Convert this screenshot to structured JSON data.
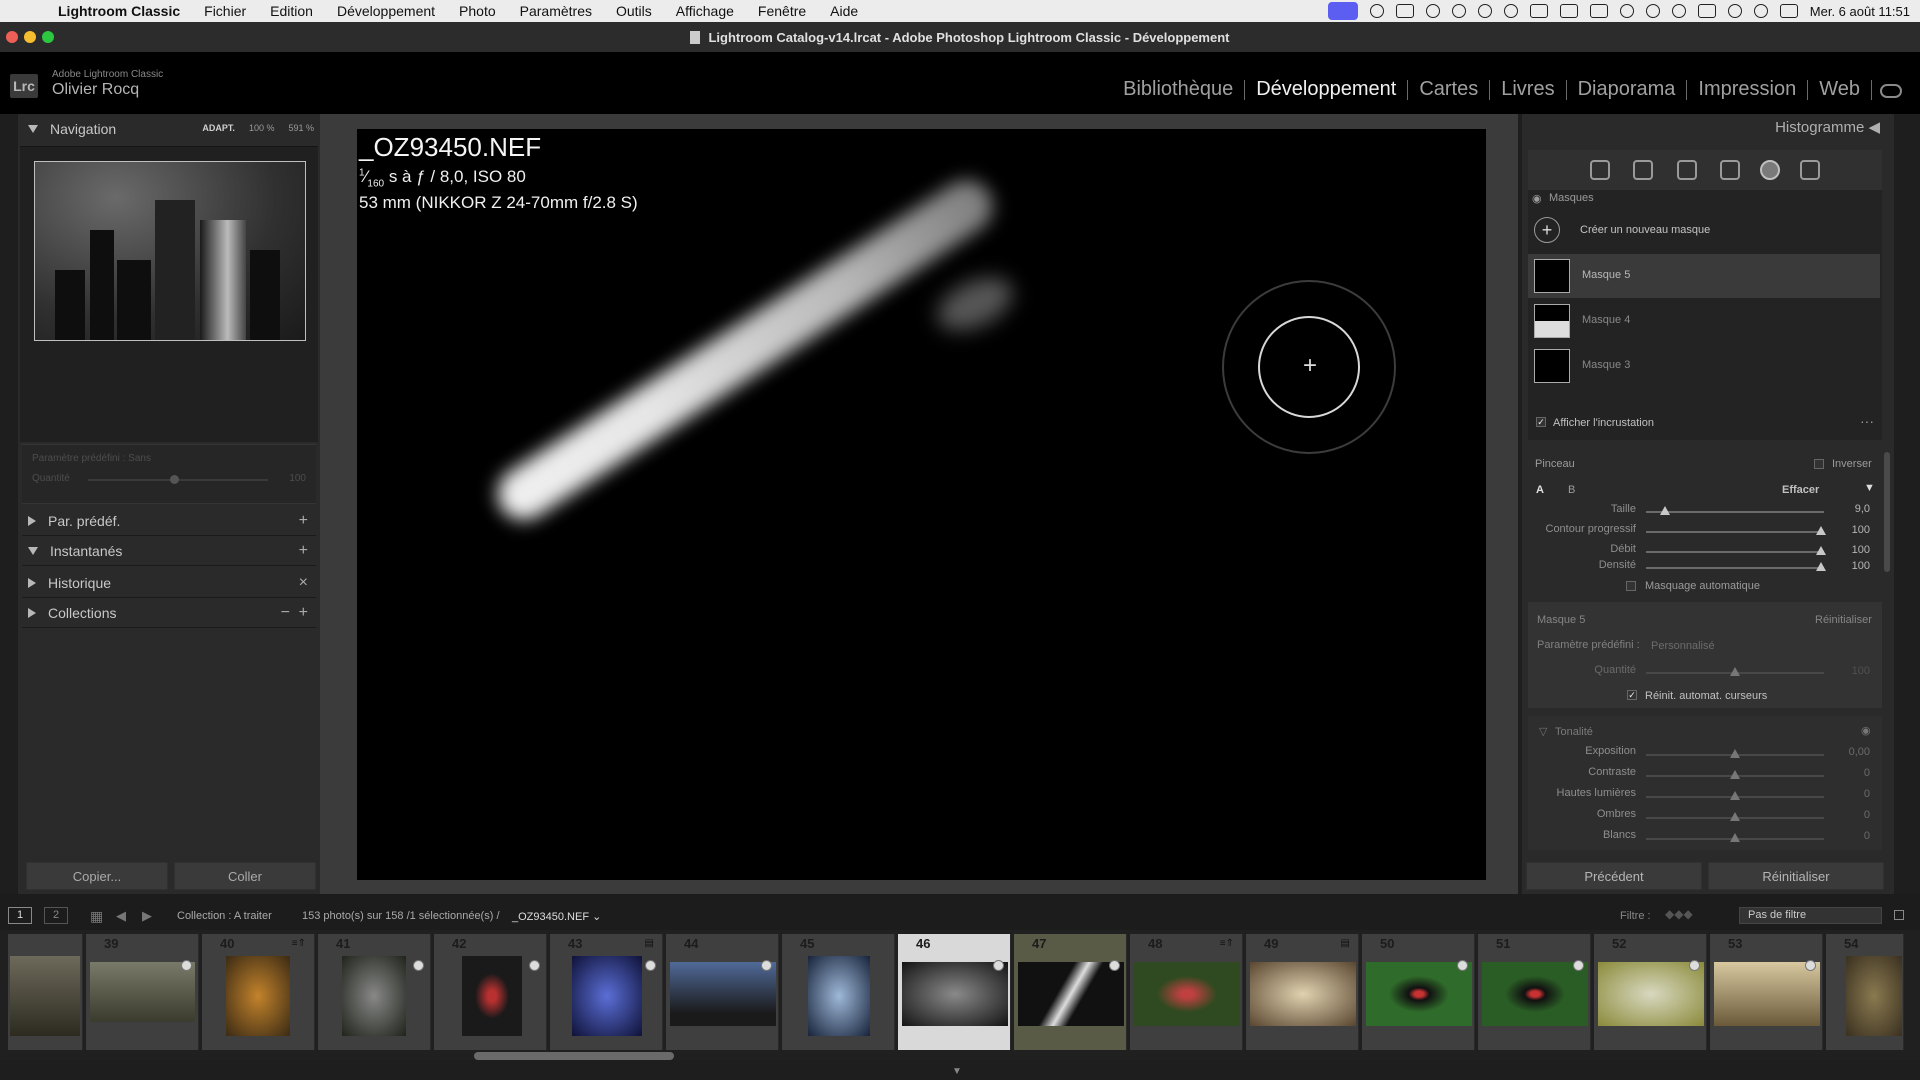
{
  "menubar": {
    "app": "Lightroom Classic",
    "items": [
      "Fichier",
      "Edition",
      "Développement",
      "Photo",
      "Paramètres",
      "Outils",
      "Affichage",
      "Fenêtre",
      "Aide"
    ],
    "datetime": "Mer. 6 août  11:51"
  },
  "window": {
    "title": "Lightroom Catalog-v14.lrcat - Adobe Photoshop Lightroom Classic - Développement"
  },
  "identity": {
    "logo": "Lrc",
    "product": "Adobe Lightroom Classic",
    "user": "Olivier Rocq"
  },
  "modules": [
    "Bibliothèque",
    "Développement",
    "Cartes",
    "Livres",
    "Diaporama",
    "Impression",
    "Web"
  ],
  "active_module": "Développement",
  "left": {
    "navigation": "Navigation",
    "nav_zoom": [
      "ADAPT.",
      "100 %",
      "591 %"
    ],
    "preset_label": "Paramètre prédéfini : Sans",
    "preset_amount_label": "Quantité",
    "preset_amount_value": "100",
    "panels": [
      "Par. prédéf.",
      "Instantanés",
      "Historique",
      "Collections"
    ],
    "copy": "Copier...",
    "paste": "Coller"
  },
  "photo": {
    "filename": "_OZ93450.NEF",
    "shutter_num": "1",
    "shutter_den": "160",
    "exposure_rest": " s à ƒ / 8,0, ISO 80",
    "lens": "53 mm (NIKKOR Z 24-70mm f/2.8 S)"
  },
  "right": {
    "histogram": "Histogramme",
    "masks_title": "Masques",
    "create_mask": "Créer un nouveau masque",
    "masks": [
      "Masque 5",
      "Masque 4",
      "Masque 3"
    ],
    "show_overlay": "Afficher l'incrustation",
    "brush_title": "Pinceau",
    "invert": "Inverser",
    "brush_a": "A",
    "brush_b": "B",
    "erase": "Effacer",
    "brush_sliders": [
      {
        "label": "Taille",
        "value": "9,0"
      },
      {
        "label": "Contour progressif",
        "value": "100"
      },
      {
        "label": "Débit",
        "value": "100"
      },
      {
        "label": "Densité",
        "value": "100"
      }
    ],
    "auto_mask": "Masquage automatique",
    "mask_name": "Masque 5",
    "reset": "Réinitialiser",
    "preset_label": "Paramètre prédéfini :",
    "preset_value": "Personnalisé",
    "amount_label": "Quantité",
    "amount_value": "100",
    "auto_reset": "Réinit. automat. curseurs",
    "tone_title": "Tonalité",
    "tone_sliders": [
      {
        "label": "Exposition",
        "value": "0,00"
      },
      {
        "label": "Contraste",
        "value": "0"
      },
      {
        "label": "Hautes lumières",
        "value": "0"
      },
      {
        "label": "Ombres",
        "value": "0"
      },
      {
        "label": "Blancs",
        "value": "0"
      }
    ],
    "previous": "Précédent",
    "reset_btn": "Réinitialiser"
  },
  "filmbar": {
    "view1": "1",
    "view2": "2",
    "source": "Collection : A traiter",
    "count": "153 photo(s) sur 158 /1 sélectionnée(s) /",
    "current": "_OZ93450.NEF",
    "filter_label": "Filtre :",
    "filter_value": "Pas de filtre"
  },
  "filmstrip": [
    "",
    "39",
    "40",
    "41",
    "42",
    "43",
    "44",
    "45",
    "46",
    "47",
    "48",
    "49",
    "50",
    "51",
    "52",
    "53",
    "54"
  ],
  "colors": {
    "accent_selected": "#d9d9d9",
    "highlight_cell": "#5a5b47"
  }
}
